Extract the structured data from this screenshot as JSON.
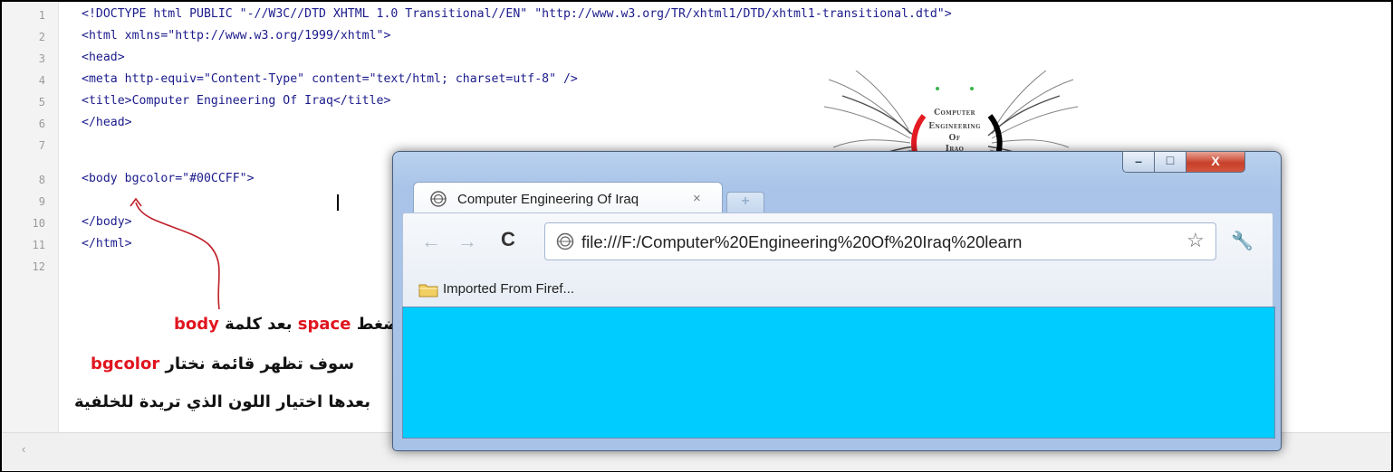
{
  "editor": {
    "line_numbers": [
      "1",
      "2",
      "3",
      "4",
      "5",
      "6",
      "7",
      "8",
      "9",
      "10",
      "11",
      "12"
    ],
    "lines": [
      "<!DOCTYPE html PUBLIC \"-//W3C//DTD XHTML 1.0 Transitional//EN\" \"http://www.w3.org/TR/xhtml1/DTD/xhtml1-transitional.dtd\">",
      "<html xmlns=\"http://www.w3.org/1999/xhtml\">",
      "<head>",
      "<meta http-equiv=\"Content-Type\" content=\"text/html; charset=utf-8\" />",
      "<title>Computer Engineering Of Iraq</title>",
      "</head>",
      "",
      "<body bgcolor=\"#00CCFF\">",
      "",
      "</body>",
      "</html>",
      ""
    ],
    "scroll_left_icon": "‹"
  },
  "annotation": {
    "line1_pre": "ضغط ",
    "line1_red1": "space",
    "line1_mid": " بعد كلمة ",
    "line1_red2": "body",
    "line2_pre": "سوف تظهر قائمة نختار ",
    "line2_red": "bgcolor",
    "line3": "بعدها اختيار اللون الذي تريدة للخلفية"
  },
  "logo": {
    "line1": "Computer",
    "line2": "Engineering",
    "line3": "Of",
    "line4": "Iraq"
  },
  "browser": {
    "tab_title": "Computer Engineering Of Iraq",
    "tab_close": "×",
    "new_tab": "+",
    "back": "←",
    "forward": "→",
    "reload": "C",
    "address": "file:///F:/Computer%20Engineering%20Of%20Iraq%20learn",
    "star": "☆",
    "wrench": "🔧",
    "bookmark": "Imported From Firef...",
    "minimize": "–",
    "maximize": "□",
    "close": "X",
    "page_background": "#00CCFF"
  }
}
